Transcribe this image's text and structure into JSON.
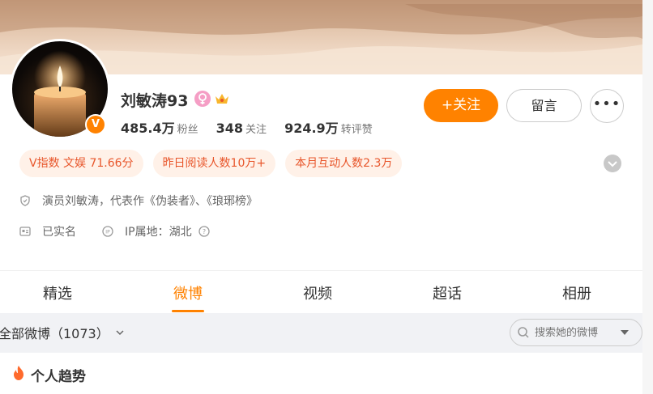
{
  "profile": {
    "name": "刘敏涛93",
    "verified_badge": "V",
    "stats": [
      {
        "value": "485.4万",
        "label": "粉丝"
      },
      {
        "value": "348",
        "label": "关注"
      },
      {
        "value": "924.9万",
        "label": "转评赞"
      }
    ],
    "follow_label": "+关注",
    "message_label": "留言",
    "more_label": "•••",
    "tags": [
      "V指数 文娱 71.66分",
      "昨日阅读人数10万+",
      "本月互动人数2.3万"
    ],
    "bio": "演员刘敏涛，代表作《伪装者》、《琅琊榜》",
    "verified_name": "已实名",
    "ip_location": "IP属地：湖北"
  },
  "tabs": [
    "精选",
    "微博",
    "视频",
    "超话",
    "相册"
  ],
  "active_tab": "微博",
  "feed": {
    "filter_label": "全部微博（1073）",
    "search_placeholder": "搜索她的微博",
    "trend_title": "个人趋势"
  },
  "colors": {
    "accent": "#ff8200",
    "tag_bg": "#fff1e8",
    "tag_text": "#e8562b"
  },
  "icons": [
    "shield-icon",
    "id-card-icon",
    "ip-icon",
    "help-icon",
    "chevron-down-icon",
    "search-icon",
    "fire-icon",
    "female-icon",
    "crown-icon",
    "candle-icon"
  ]
}
